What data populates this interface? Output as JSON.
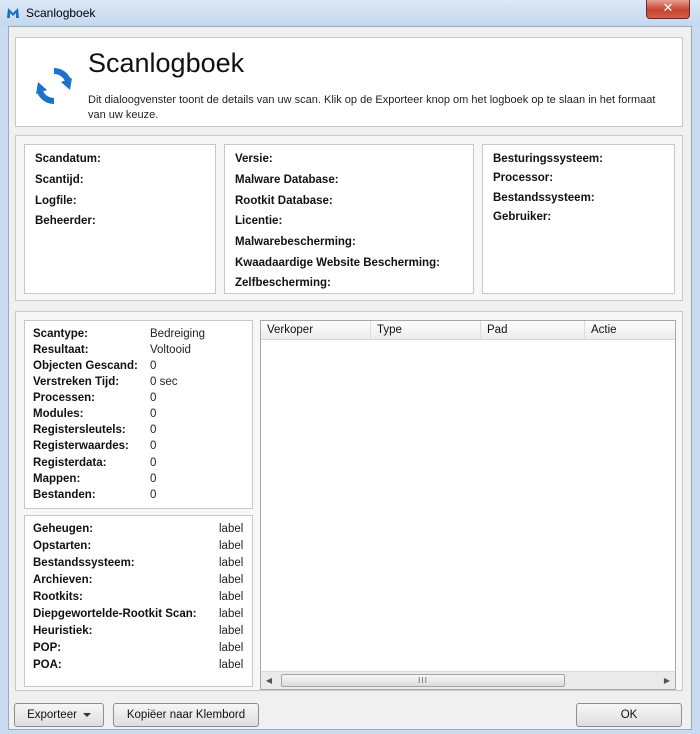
{
  "window": {
    "title": "Scanlogboek",
    "close_label": "✕"
  },
  "header": {
    "title": "Scanlogboek",
    "description": "Dit dialoogvenster toont de details van uw scan. Klik op de Exporteer knop om het logboek op te slaan in het formaat van uw keuze."
  },
  "info": {
    "col1": [
      "Scandatum:",
      "Scantijd:",
      "Logfile:",
      "Beheerder:"
    ],
    "col2": [
      "Versie:",
      "Malware Database:",
      "Rootkit Database:",
      "Licentie:",
      "Malwarebescherming:",
      "Kwaadaardige Website Bescherming:",
      "Zelfbescherming:"
    ],
    "col3": [
      "Besturingssysteem:",
      "Processor:",
      "Bestandssysteem:",
      "Gebruiker:"
    ]
  },
  "stats": [
    {
      "k": "Scantype:",
      "v": "Bedreiging"
    },
    {
      "k": "Resultaat:",
      "v": "Voltooid"
    },
    {
      "k": "Objecten Gescand:",
      "v": "0"
    },
    {
      "k": "Verstreken Tijd:",
      "v": "0 sec"
    },
    {
      "k": "Processen:",
      "v": "0"
    },
    {
      "k": "Modules:",
      "v": "0"
    },
    {
      "k": "Registersleutels:",
      "v": "0"
    },
    {
      "k": "Registerwaardes:",
      "v": "0"
    },
    {
      "k": "Registerdata:",
      "v": "0"
    },
    {
      "k": "Mappen:",
      "v": "0"
    },
    {
      "k": "Bestanden:",
      "v": "0"
    }
  ],
  "details": [
    {
      "k": "Geheugen:",
      "v": "label"
    },
    {
      "k": "Opstarten:",
      "v": "label"
    },
    {
      "k": "Bestandssysteem:",
      "v": "label"
    },
    {
      "k": "Archieven:",
      "v": "label"
    },
    {
      "k": "Rootkits:",
      "v": "label"
    },
    {
      "k": "Diepgewortelde-Rootkit Scan:",
      "v": "label"
    },
    {
      "k": "Heuristiek:",
      "v": "label"
    },
    {
      "k": "POP:",
      "v": "label"
    },
    {
      "k": "POA:",
      "v": "label"
    }
  ],
  "table": {
    "columns": [
      "Verkoper",
      "Type",
      "Pad",
      "Actie"
    ],
    "scroll_grip": "III"
  },
  "buttons": {
    "export": "Exporteer",
    "copy": "Kopiëer naar Klembord",
    "ok": "OK"
  },
  "colors": {
    "icon_blue": "#1a73c8",
    "close_red": "#c7432e"
  }
}
